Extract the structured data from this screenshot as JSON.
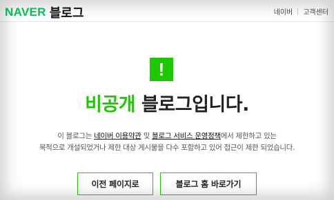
{
  "header": {
    "logo_naver": "NAVER",
    "logo_blog": "블로그",
    "nav": [
      {
        "label": "네이버"
      },
      {
        "label": "고객센터"
      }
    ]
  },
  "alert": {
    "icon": "exclamation-icon",
    "glyph": "!"
  },
  "title": {
    "accent": "비공개",
    "rest": " 블로그입니다."
  },
  "description": {
    "line1_prefix": "이 블로그는 ",
    "link_terms": "네이버 이용약관",
    "line1_and": " 및 ",
    "link_policy": "블로그 서비스 운영정책",
    "line1_suffix": "에서 제한하고 있는",
    "line2": "목적으로 개설되었거나 제한 대상 게시물을 다수 포함하고 있어 접근이 제한 되었습니다."
  },
  "buttons": {
    "prev": "이전 페이지로",
    "home": "블로그 홈 바로가기"
  },
  "colors": {
    "brand_green": "#1ec800",
    "naver_green": "#03c75a"
  }
}
